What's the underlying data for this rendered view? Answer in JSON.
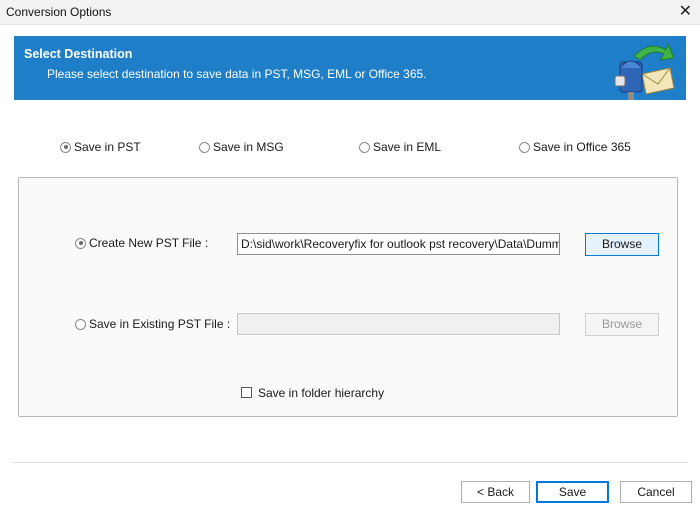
{
  "window": {
    "title": "Conversion Options",
    "close_glyph": "✕"
  },
  "banner": {
    "title": "Select Destination",
    "subtitle": "Please select destination to save data in PST, MSG, EML or Office 365.",
    "icon": "mailbox-transfer-icon"
  },
  "save_format": {
    "selected": "Save in PST",
    "options": [
      {
        "label": "Save in PST",
        "selected": true
      },
      {
        "label": "Save in MSG",
        "selected": false
      },
      {
        "label": "Save in EML",
        "selected": false
      },
      {
        "label": "Save in Office 365",
        "selected": false
      }
    ]
  },
  "pst_options": {
    "create_new": {
      "label": "Create New PST File :",
      "selected": true,
      "path": "D:\\sid\\work\\Recoveryfix for outlook pst recovery\\Data\\Dummy MBO",
      "browse_label": "Browse"
    },
    "existing": {
      "label": "Save in Existing PST File :",
      "selected": false,
      "path": "",
      "browse_label": "Browse"
    },
    "folder_hierarchy": {
      "label": "Save in folder hierarchy",
      "checked": false
    }
  },
  "footer": {
    "back_label": "< Back",
    "save_label": "Save",
    "cancel_label": "Cancel"
  },
  "colors": {
    "banner": "#1e7ec8",
    "accent": "#0078d7"
  }
}
